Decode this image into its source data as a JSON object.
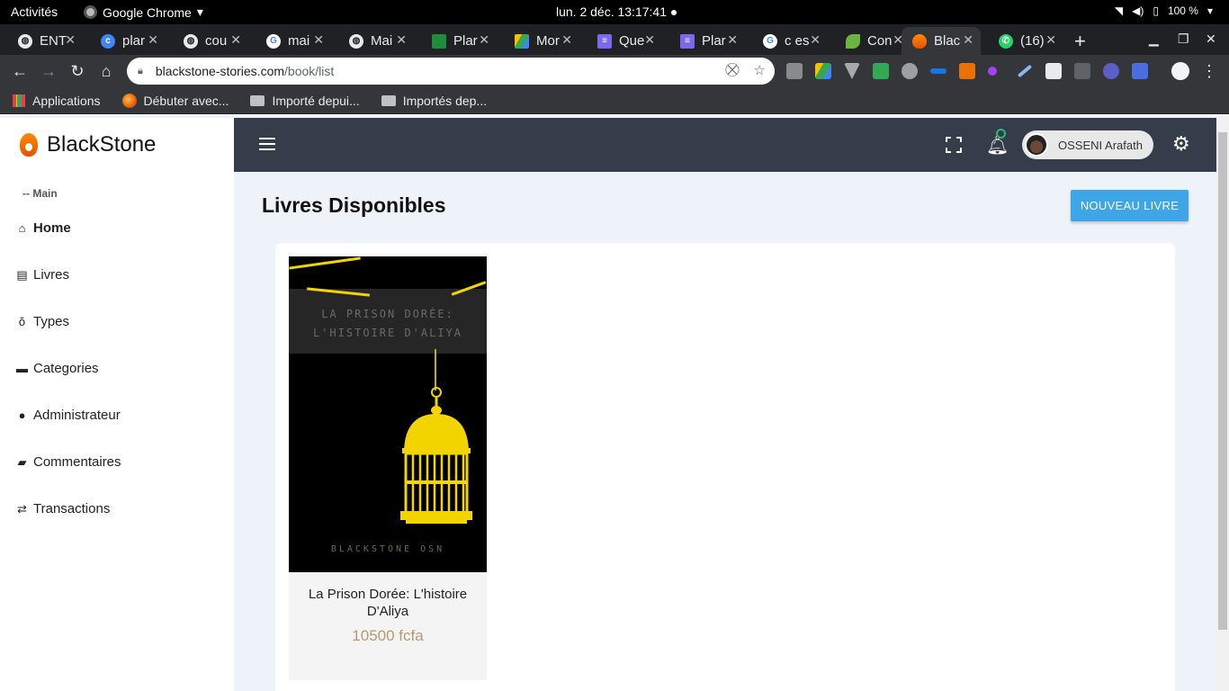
{
  "system": {
    "activities": "Activités",
    "app_name": "Google Chrome",
    "clock": "lun. 2 déc.  13:17:41 ●",
    "battery": "100 %"
  },
  "browser": {
    "tabs": [
      {
        "title": "ENT",
        "icon": "globe-icon"
      },
      {
        "title": "plar",
        "icon": "circle-c-icon"
      },
      {
        "title": "cou",
        "icon": "globe-icon"
      },
      {
        "title": "mai",
        "icon": "google-icon"
      },
      {
        "title": "Mai",
        "icon": "globe-icon"
      },
      {
        "title": "Plar",
        "icon": "green-doc-icon"
      },
      {
        "title": "Mor",
        "icon": "drive-icon"
      },
      {
        "title": "Que",
        "icon": "docs-icon"
      },
      {
        "title": "Plar",
        "icon": "docs-icon"
      },
      {
        "title": "c es",
        "icon": "google-icon"
      },
      {
        "title": "Con",
        "icon": "leaf-icon"
      },
      {
        "title": "Blac",
        "icon": "blackstone-icon",
        "active": true
      },
      {
        "title": "(16)",
        "icon": "whatsapp-icon"
      }
    ],
    "url_host": "blackstone-stories.com",
    "url_path": "/book/list",
    "bookmarks": [
      "Applications",
      "Débuter avec...",
      "Importé depui...",
      "Importés dep..."
    ]
  },
  "app": {
    "brand": "BlackStone",
    "section_label": "-- Main",
    "nav": [
      {
        "label": "Home",
        "icon": "home-icon"
      },
      {
        "label": "Livres",
        "icon": "book-icon"
      },
      {
        "label": "Types",
        "icon": "type-icon"
      },
      {
        "label": "Categories",
        "icon": "archive-icon"
      },
      {
        "label": "Administrateur",
        "icon": "user-icon"
      },
      {
        "label": "Commentaires",
        "icon": "comment-icon"
      },
      {
        "label": "Transactions",
        "icon": "exchange-icon"
      }
    ],
    "user_name": "OSSENI Arafath",
    "page_title": "Livres Disponibles",
    "new_button": "NOUVEAU LIVRE",
    "books": [
      {
        "cover_title_line1": "LA PRISON DORÉE:",
        "cover_title_line2": "L'HISTOIRE D'ALIYA",
        "cover_author": "BLACKSTONE OSN",
        "title": "La Prison Dorée: L'histoire D'Aliya",
        "price": "10500 fcfa"
      }
    ]
  },
  "colors": {
    "header_bg": "#363d4a",
    "accent_button": "#3ea6e6",
    "price": "#b59b6b",
    "cover_gold": "#f2d400"
  }
}
